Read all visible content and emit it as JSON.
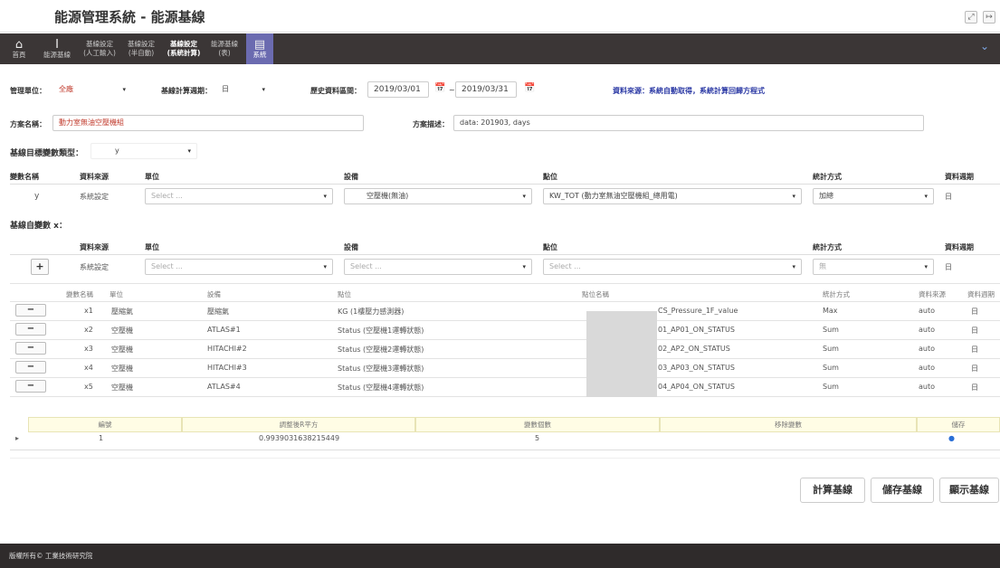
{
  "app": {
    "title": "能源管理系統 - 能源基線"
  },
  "nav": {
    "items": [
      {
        "label": "首頁",
        "icon": "home-icon",
        "glyph": "⌂"
      },
      {
        "label": "能源基線",
        "icon": "marker-icon",
        "glyph": "I"
      },
      {
        "label": "基線設定\n(人工輸入)"
      },
      {
        "label": "基線設定\n(半自動)"
      },
      {
        "label": "基線設定\n(系統計算)"
      },
      {
        "label": "能源基線\n(表)"
      },
      {
        "label": "系統",
        "icon": "list-icon",
        "glyph": "▤"
      }
    ],
    "expand_glyph": "⌄"
  },
  "filters": {
    "unit_label": "管理單位：",
    "unit_value": "全廠",
    "period_label": "基線計算週期：",
    "period_value": "日",
    "range_label": "歷史資料區間：",
    "start_date": "2019/03/01",
    "tilde": "~",
    "end_date": "2019/03/31",
    "source_note": "資料來源：系統自動取得，系統計算回歸方程式"
  },
  "scheme": {
    "name_label": "方案名稱：",
    "name_value": "動力室無油空壓機組",
    "desc_label": "方案描述：",
    "desc_value": "data: 201903, days"
  },
  "target": {
    "type_label": "基線目標變數類型：",
    "type_value": "y",
    "headers": [
      "變數名稱",
      "資料來源",
      "單位",
      "設備",
      "點位",
      "統計方式",
      "資料週期"
    ],
    "row": {
      "name": "y",
      "source": "系統設定",
      "unit": "Select ...",
      "device": "空壓機(無油)",
      "point": "KW_TOT (動力室無油空壓機組_總用電)",
      "stat": "加總",
      "cycle": "日"
    }
  },
  "independent": {
    "label": "基線自變數 x：",
    "headers": [
      "資料來源",
      "單位",
      "設備",
      "點位",
      "統計方式",
      "資料週期"
    ],
    "row": {
      "add": "+",
      "source": "系統設定",
      "unit": "Select ...",
      "device": "Select ...",
      "point": "Select ...",
      "stat": "無",
      "cycle": "日"
    }
  },
  "grid": {
    "headers": [
      "變數名稱",
      "單位",
      "設備",
      "點位",
      "點位名稱",
      "統計方式",
      "資料來源",
      "資料週期"
    ],
    "remove_label": "−",
    "rows": [
      {
        "var": "x1",
        "unit": "壓縮氣",
        "device": "壓縮氣",
        "point": "KG (1樓壓力感測器)",
        "pname": "CS_Pressure_1F_value",
        "stat": "Max",
        "src": "auto",
        "cycle": "日"
      },
      {
        "var": "x2",
        "unit": "空壓機",
        "device": "ATLAS#1",
        "point": "Status (空壓機1運轉狀態)",
        "pname": "01_AP01_ON_STATUS",
        "stat": "Sum",
        "src": "auto",
        "cycle": "日"
      },
      {
        "var": "x3",
        "unit": "空壓機",
        "device": "HITACHI#2",
        "point": "Status (空壓機2運轉狀態)",
        "pname": "02_AP2_ON_STATUS",
        "stat": "Sum",
        "src": "auto",
        "cycle": "日"
      },
      {
        "var": "x4",
        "unit": "空壓機",
        "device": "HITACHI#3",
        "point": "Status (空壓機3運轉狀態)",
        "pname": "03_AP03_ON_STATUS",
        "stat": "Sum",
        "src": "auto",
        "cycle": "日"
      },
      {
        "var": "x5",
        "unit": "空壓機",
        "device": "ATLAS#4",
        "point": "Status (空壓機4運轉狀態)",
        "pname": "04_AP04_ON_STATUS",
        "stat": "Sum",
        "src": "auto",
        "cycle": "日"
      }
    ]
  },
  "results": {
    "headers": [
      "編號",
      "調整後R平方",
      "變數個數",
      "移除變數",
      "儲存"
    ],
    "row": {
      "marker": "▸",
      "id": "1",
      "r2": "0.9939031638215449",
      "count": "5",
      "removed": "",
      "save": "●"
    }
  },
  "actions": {
    "calc": "計算基線",
    "save": "儲存基線",
    "show": "顯示基線"
  },
  "footer": {
    "text": "版權所有© 工業技術研究院"
  }
}
